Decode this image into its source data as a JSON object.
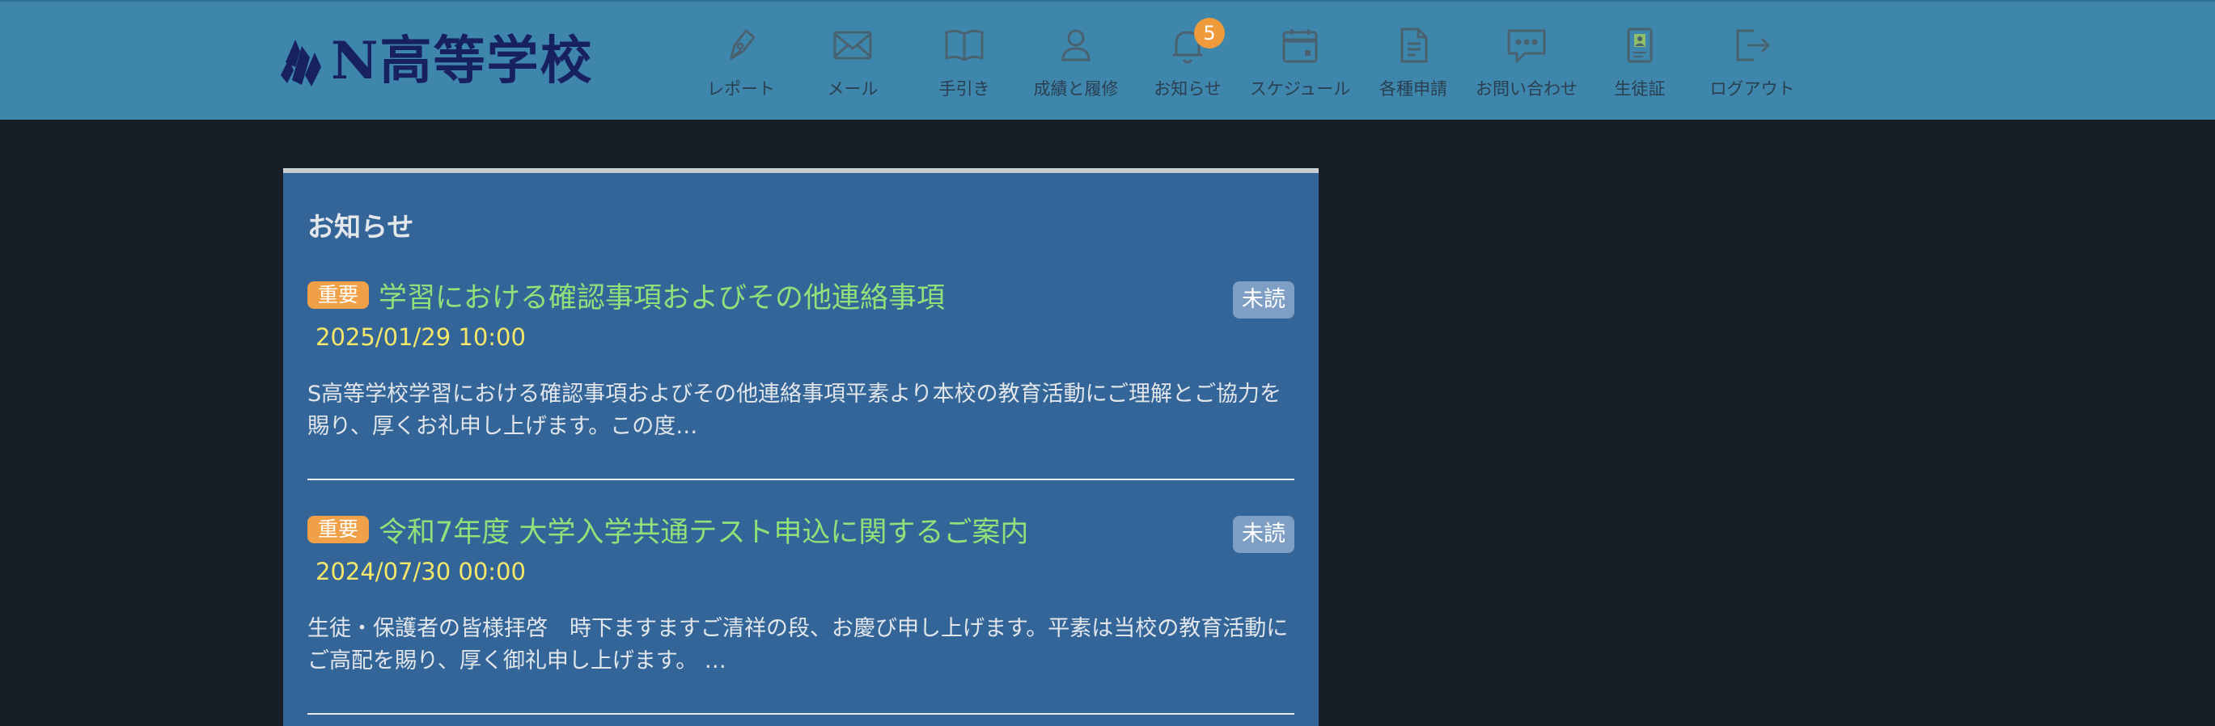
{
  "header": {
    "logo_text": "N高等学校",
    "nav": [
      {
        "label": "レポート",
        "icon": "pen-icon"
      },
      {
        "label": "メール",
        "icon": "mail-icon"
      },
      {
        "label": "手引き",
        "icon": "book-icon"
      },
      {
        "label": "成績と履修",
        "icon": "person-icon"
      },
      {
        "label": "お知らせ",
        "icon": "bell-icon",
        "badge": "5"
      },
      {
        "label": "スケジュール",
        "icon": "calendar-icon"
      },
      {
        "label": "各種申請",
        "icon": "document-icon"
      },
      {
        "label": "お問い合わせ",
        "icon": "chat-icon"
      },
      {
        "label": "生徒証",
        "icon": "id-card-icon"
      },
      {
        "label": "ログアウト",
        "icon": "logout-icon"
      }
    ]
  },
  "notices": {
    "title": "お知らせ",
    "items": [
      {
        "badge": "重要",
        "title": "学習における確認事項およびその他連絡事項",
        "status": "未読",
        "date": "2025/01/29 10:00",
        "excerpt": "S高等学校学習における確認事項およびその他連絡事項平素より本校の教育活動にご理解とご協力を賜り、厚くお礼申し上げます。この度…"
      },
      {
        "badge": "重要",
        "title": "令和7年度 大学入学共通テスト申込に関するご案内",
        "status": "未読",
        "date": "2024/07/30 00:00",
        "excerpt": "生徒・保護者の皆様拝啓　時下ますますご清祥の段、お慶び申し上げます。平素は当校の教育活動にご高配を賜り、厚く御礼申し上げます。 …"
      }
    ]
  },
  "colors": {
    "header_bg": "#3f86ad",
    "page_bg": "#171e27",
    "panel_bg": "#336598",
    "title_green": "#8fe27a",
    "date_yellow": "#f5e76a",
    "important_orange": "#f0a046",
    "unread_blue": "#7f9ec3"
  }
}
